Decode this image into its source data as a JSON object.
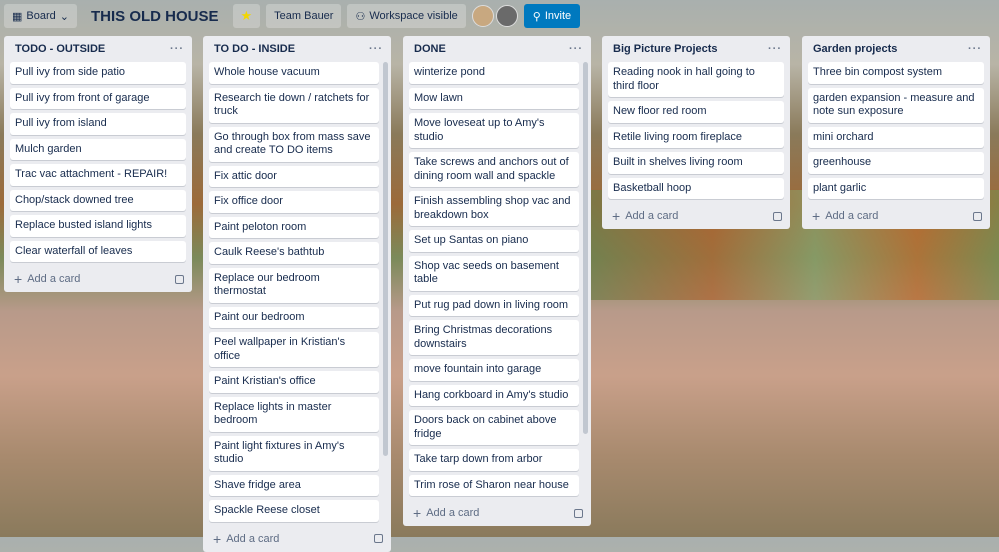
{
  "topbar": {
    "board_view": "Board",
    "title": "THIS OLD HOUSE",
    "team": "Team Bauer",
    "visibility": "Workspace visible",
    "invite": "Invite"
  },
  "add_card": "Add a card",
  "lists": [
    {
      "title": "TODO - OUTSIDE",
      "cards": [
        "Pull ivy from side patio",
        "Pull ivy from front of garage",
        "Pull ivy from island",
        "Mulch garden",
        "Trac vac attachment - REPAIR!",
        "Chop/stack downed tree",
        "Replace busted island lights",
        "Clear waterfall of leaves"
      ]
    },
    {
      "title": "TO DO - INSIDE",
      "cards": [
        "Whole house vacuum",
        "Research tie down / ratchets for truck",
        "Go through box from mass save and create TO DO items",
        "Fix attic door",
        "Fix office door",
        "Paint peloton room",
        "Caulk Reese's bathtub",
        "Replace our bedroom thermostat",
        "Paint our bedroom",
        "Peel wallpaper in Kristian's office",
        "Paint Kristian's office",
        "Replace lights in master bedroom",
        "Paint light fixtures in Amy's studio",
        "Shave fridge area",
        "Spackle Reese closet"
      ]
    },
    {
      "title": "DONE",
      "cards": [
        "winterize pond",
        "Mow lawn",
        "Move loveseat up to Amy's studio",
        "Take screws and anchors out of dining room wall and spackle",
        "Finish assembling shop vac and breakdown box",
        "Set up Santas on piano",
        "Shop vac seeds on basement table",
        "Put rug pad down in living room",
        "Bring Christmas decorations downstairs",
        "move fountain into garage",
        "Hang corkboard in Amy's studio",
        "Doors back on cabinet above fridge",
        "Take tarp down from arbor",
        "Trim rose of Sharon near house"
      ]
    },
    {
      "title": "Big Picture Projects",
      "cards": [
        "Reading nook in hall going to third floor",
        "New floor red room",
        "Retile living room fireplace",
        "Built in shelves living room",
        "Basketball hoop"
      ]
    },
    {
      "title": "Garden projects",
      "cards": [
        "Three bin compost system",
        "garden expansion - measure and note sun exposure",
        "mini orchard",
        "greenhouse",
        "plant garlic"
      ]
    }
  ]
}
